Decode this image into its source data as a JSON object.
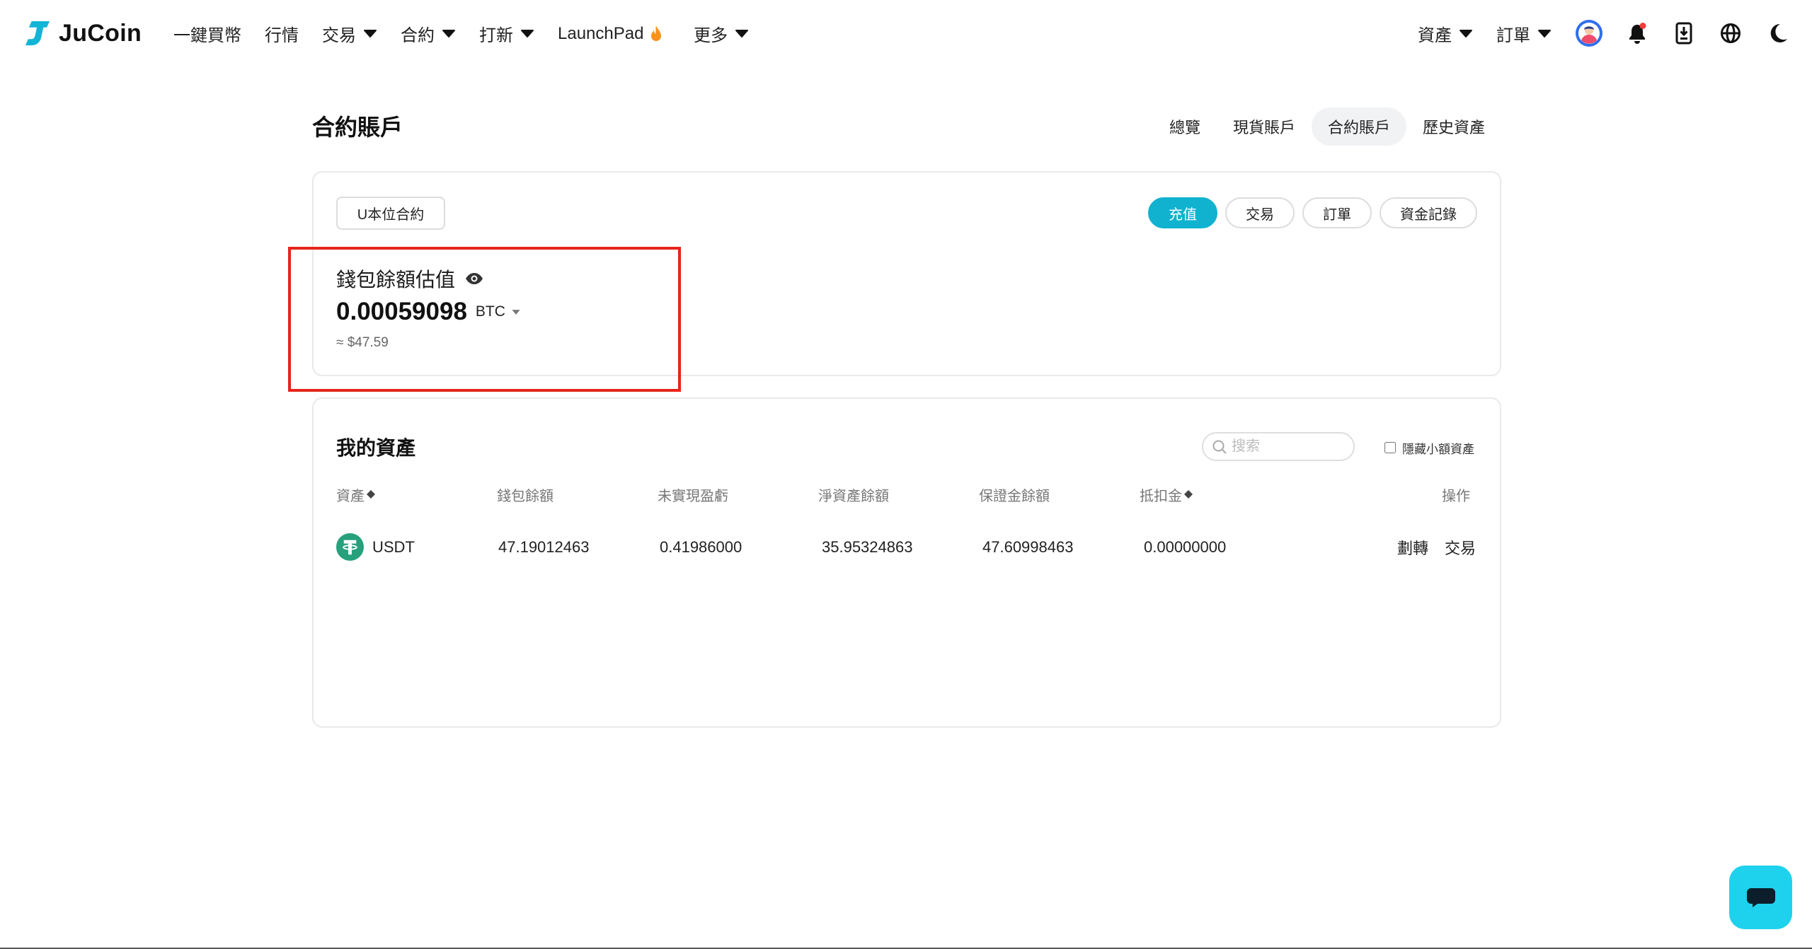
{
  "brand": {
    "name": "JuCoin",
    "logo_icon": "jucoin-logo-icon"
  },
  "nav": {
    "items": [
      {
        "label": "一鍵買幣"
      },
      {
        "label": "行情"
      },
      {
        "label": "交易",
        "icon": "caret-down-icon"
      },
      {
        "label": "合約",
        "icon": "caret-down-icon"
      },
      {
        "label": "打新",
        "icon": "caret-down-icon"
      },
      {
        "label": "LaunchPad",
        "icon": "flame-icon"
      },
      {
        "label": "更多",
        "icon": "caret-down-icon"
      }
    ]
  },
  "user_nav": {
    "items": [
      {
        "label": "資產",
        "icon": "caret-down-icon"
      },
      {
        "label": "訂單",
        "icon": "caret-down-icon"
      }
    ],
    "icons": [
      "avatar",
      "bell-icon",
      "download-icon",
      "globe-icon",
      "moon-icon"
    ],
    "notification_dot": true
  },
  "page": {
    "title": "合約賬戶",
    "tabs": [
      {
        "label": "總覽",
        "active": false
      },
      {
        "label": "現貨賬戶",
        "active": false
      },
      {
        "label": "合約賬戶",
        "active": true
      },
      {
        "label": "歷史資產",
        "active": false
      }
    ]
  },
  "summary": {
    "contract_type": "U本位合約",
    "actions": [
      {
        "label": "充值",
        "primary": true
      },
      {
        "label": "交易",
        "primary": false
      },
      {
        "label": "訂單",
        "primary": false
      },
      {
        "label": "資金記錄",
        "primary": false
      }
    ],
    "balance_label": "錢包餘額估值",
    "visibility_icon": "eye-icon",
    "balance_value": "0.00059098",
    "balance_unit": "BTC",
    "balance_fiat": "≈ $47.59"
  },
  "assets": {
    "title": "我的資產",
    "search_placeholder": "搜索",
    "hide_small_label": "隱藏小額資產",
    "hide_small_checked": false,
    "columns": [
      {
        "label": "資產",
        "icon": "sort-icon"
      },
      {
        "label": "錢包餘額"
      },
      {
        "label": "未實現盈虧"
      },
      {
        "label": "淨資產餘額"
      },
      {
        "label": "保證金餘額"
      },
      {
        "label": "抵扣金",
        "icon": "sort-icon"
      },
      {
        "label": "操作"
      }
    ],
    "rows": [
      {
        "asset": "USDT",
        "asset_icon": "usdt-icon",
        "wallet_balance": "47.19012463",
        "unrealized_pnl": "0.41986000",
        "net_asset_balance": "35.95324863",
        "margin_balance": "47.60998463",
        "deduction_balance": "0.00000000",
        "actions": [
          "劃轉",
          "交易"
        ]
      }
    ]
  },
  "support": {
    "icon": "chat-icon"
  },
  "colors": {
    "accent": "#10b2cf",
    "chat_button": "#1ed2ee",
    "brand_logo": "#13b5d6",
    "annotation": "#e4261c",
    "notification_dot": "#f23c3c",
    "usdt": "#26a17b",
    "flame": "#f7931a"
  }
}
